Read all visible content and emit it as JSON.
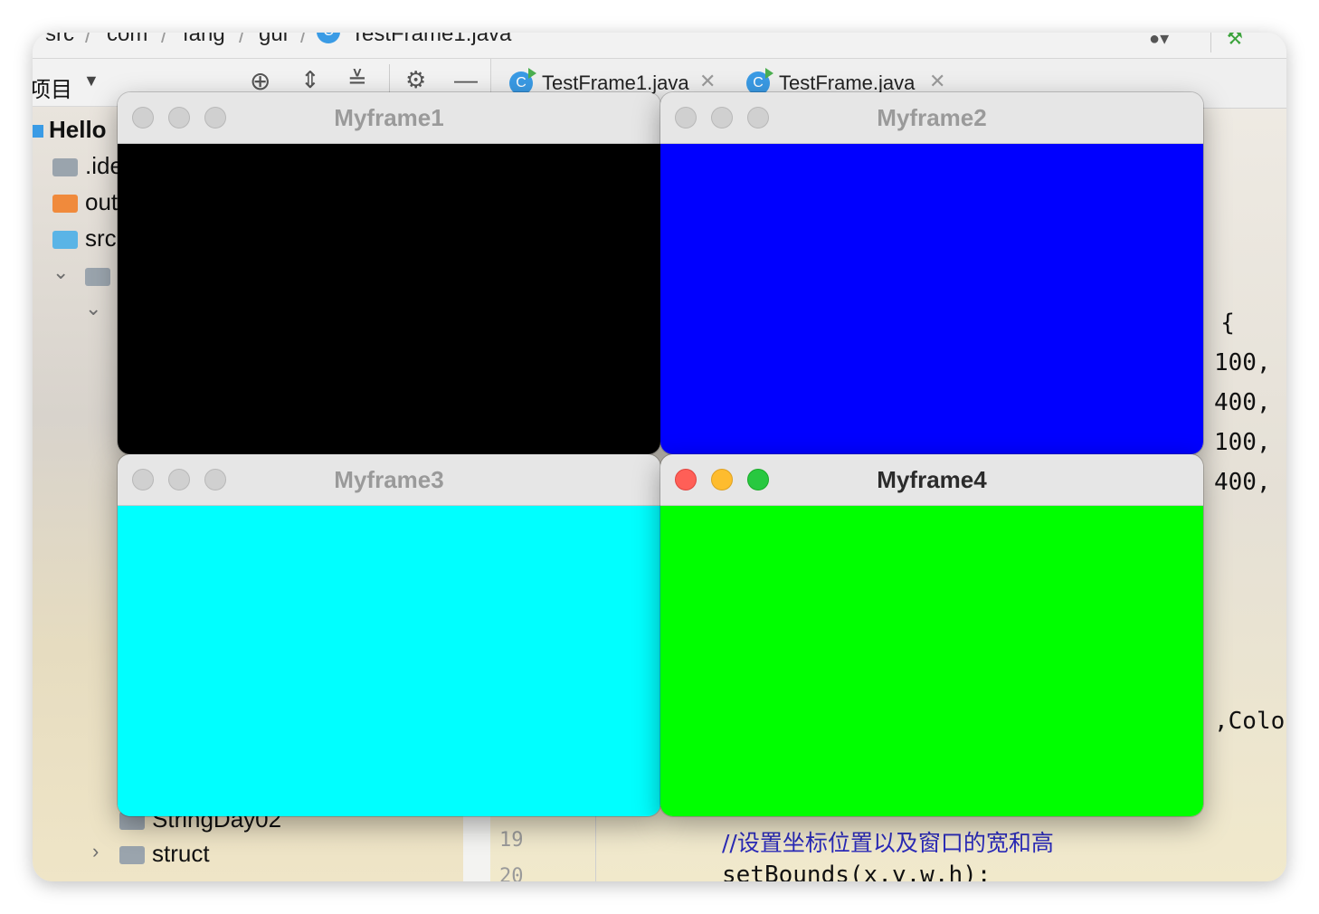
{
  "ide": {
    "breadcrumb": [
      "src",
      "com",
      "fang",
      "gui",
      "TestFrame1.java"
    ],
    "toolbar": {
      "project_label": "项目"
    },
    "tabs": [
      {
        "label": "TestFrame1.java",
        "active": true
      },
      {
        "label": "TestFrame.java",
        "active": false
      }
    ],
    "tree": {
      "root": "Hello",
      "items": [
        ".ide",
        "out",
        "src",
        "StringDay02",
        "struct"
      ]
    },
    "gutter": [
      "19",
      "20"
    ],
    "code_fragments": {
      "brace": ") {",
      "v1": "100,",
      "v2": "400,",
      "v3": "100,",
      "v4": "400,",
      "colo": ",Colo",
      "comment": "//设置坐标位置以及窗口的宽和高",
      "setbounds": "setBounds(x,y,w,h);"
    }
  },
  "frames": [
    {
      "title": "Myframe1",
      "color": "#000000",
      "focused": false
    },
    {
      "title": "Myframe2",
      "color": "#0000ff",
      "focused": false
    },
    {
      "title": "Myframe3",
      "color": "#00ffff",
      "focused": false
    },
    {
      "title": "Myframe4",
      "color": "#00ff00",
      "focused": true
    }
  ],
  "colors": {
    "traffic_red": "#ff5f57",
    "traffic_yellow": "#febc2e",
    "traffic_green": "#28c840",
    "traffic_inactive": "#d0d0d0"
  }
}
